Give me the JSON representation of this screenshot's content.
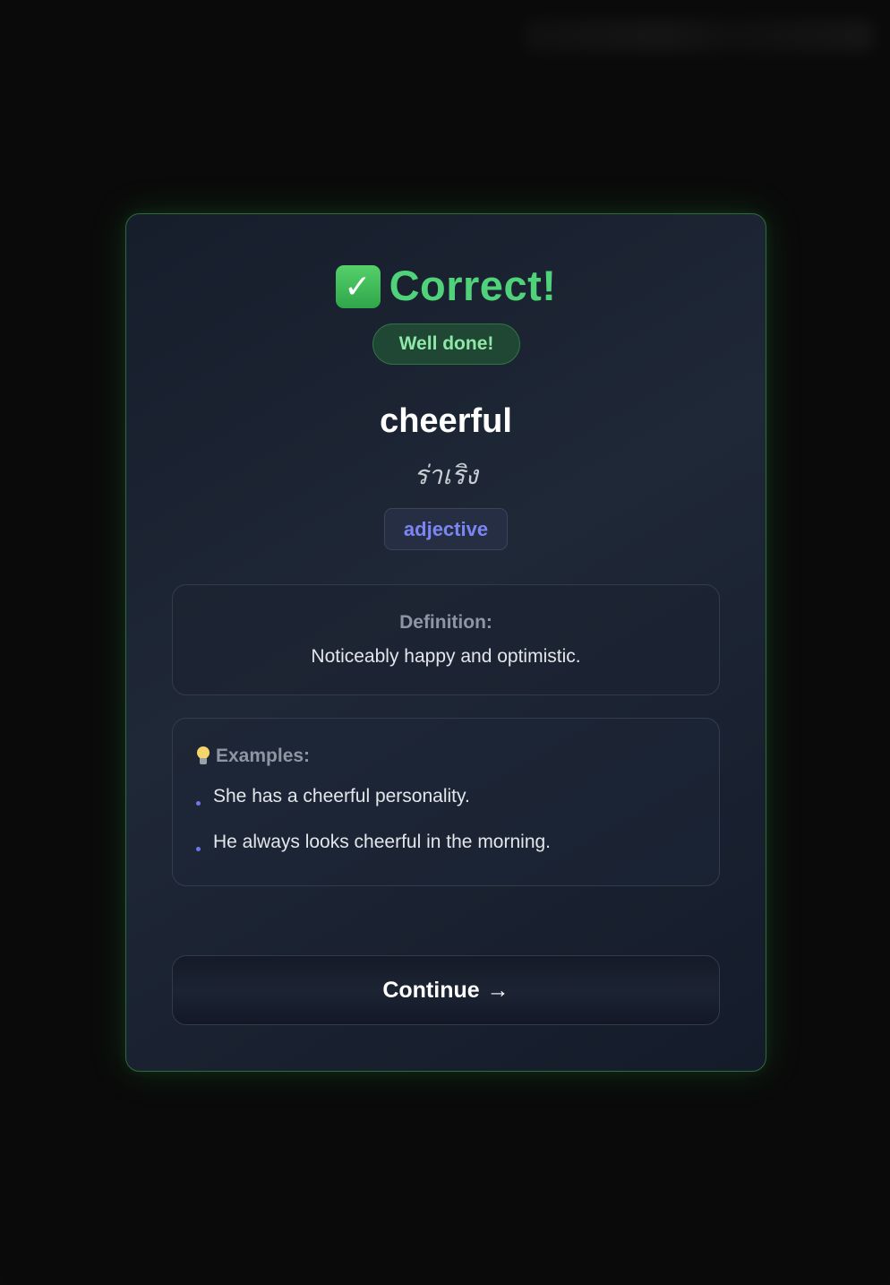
{
  "result": {
    "title": "Correct!",
    "icon": "check-mark-button-icon",
    "badge": "Well done!"
  },
  "word": {
    "term": "cheerful",
    "translation": "ร่าเริง",
    "part_of_speech": "adjective"
  },
  "definition": {
    "label": "Definition:",
    "text": "Noticeably happy and optimistic."
  },
  "examples": {
    "icon": "lightbulb-icon",
    "label": "Examples:",
    "items": [
      "She has a cheerful personality.",
      "He always looks cheerful in the morning."
    ]
  },
  "actions": {
    "continue_label": "Continue",
    "continue_icon": "→"
  },
  "colors": {
    "success": "#4fd27a",
    "accent": "#7c86f2",
    "card_border": "#2f6b3a"
  }
}
